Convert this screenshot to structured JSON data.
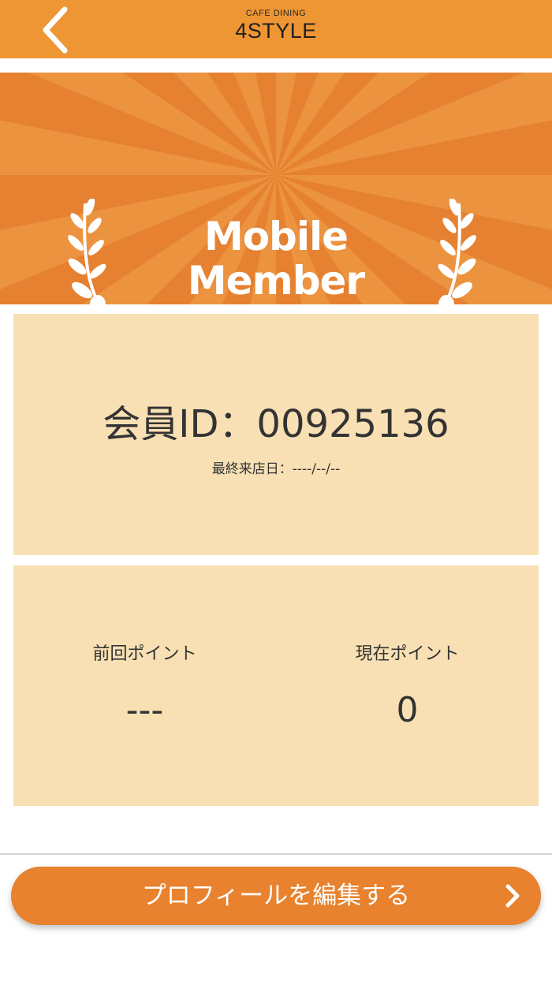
{
  "header": {
    "logo_small": "CAFE DINING",
    "logo_big": "4STYLE",
    "back_icon": "chevron-left-icon"
  },
  "banner": {
    "title_line1": "Mobile",
    "title_line2": "Member"
  },
  "member": {
    "id_text": "会員ID：00925136",
    "last_visit_text": "最終来店日：----/--/--"
  },
  "points": {
    "previous_label": "前回ポイント",
    "previous_value": "---",
    "current_label": "現在ポイント",
    "current_value": "0"
  },
  "actions": {
    "edit_profile_label": "プロフィールを編集する"
  },
  "colors": {
    "header": "#ee9534",
    "banner_dark": "#e58130",
    "banner_light": "#ec9340",
    "card": "#f8e0b4",
    "button": "#e8822e"
  }
}
